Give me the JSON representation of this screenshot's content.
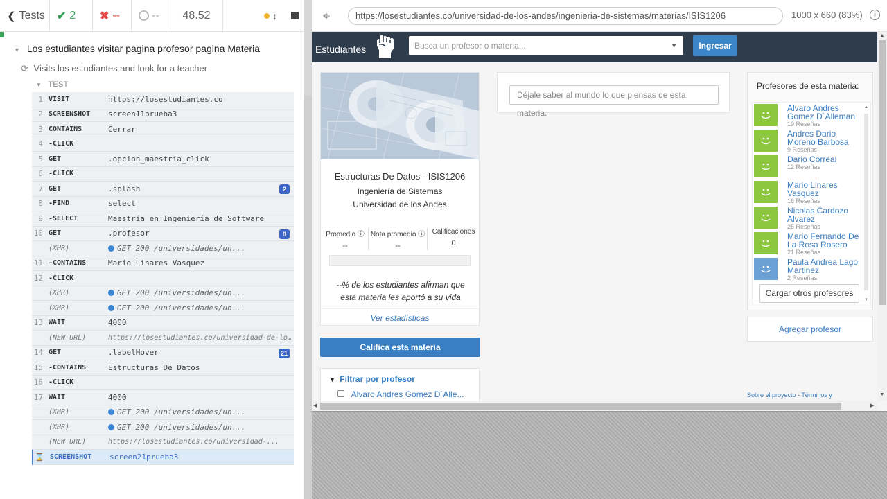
{
  "reporter": {
    "tests_label": "Tests",
    "passed": "2",
    "failed": "--",
    "pending": "--",
    "duration": "48.52",
    "suite_title": "Los estudiantes visitar pagina profesor pagina Materia",
    "test_title": "Visits los estudiantes and look for a teacher",
    "section_label": "TEST",
    "commands": [
      {
        "num": "1",
        "name": "VISIT",
        "msg": "https://losestudiantes.co",
        "kind": "cmd",
        "badge": ""
      },
      {
        "num": "2",
        "name": "SCREENSHOT",
        "msg": "screen11prueba3",
        "kind": "cmd",
        "badge": ""
      },
      {
        "num": "3",
        "name": "CONTAINS",
        "msg": "Cerrar",
        "kind": "cmd",
        "badge": ""
      },
      {
        "num": "4",
        "name": "-CLICK",
        "msg": "",
        "kind": "sub",
        "badge": ""
      },
      {
        "num": "5",
        "name": "GET",
        "msg": ".opcion_maestria_click",
        "kind": "cmd",
        "badge": ""
      },
      {
        "num": "6",
        "name": "-CLICK",
        "msg": "",
        "kind": "sub",
        "badge": ""
      },
      {
        "num": "7",
        "name": "GET",
        "msg": ".splash",
        "kind": "cmd",
        "badge": "2"
      },
      {
        "num": "8",
        "name": "-FIND",
        "msg": "select",
        "kind": "sub",
        "badge": ""
      },
      {
        "num": "9",
        "name": "-SELECT",
        "msg": "Maestría en Ingeniería de Software",
        "kind": "sub",
        "badge": ""
      },
      {
        "num": "10",
        "name": "GET",
        "msg": ".profesor",
        "kind": "cmd",
        "badge": "8"
      },
      {
        "num": "",
        "name": "(XHR)",
        "msg": "GET 200 /universidades/un...",
        "kind": "xhr",
        "badge": ""
      },
      {
        "num": "11",
        "name": "-CONTAINS",
        "msg": "Mario Linares Vasquez",
        "kind": "sub",
        "badge": ""
      },
      {
        "num": "12",
        "name": "-CLICK",
        "msg": "",
        "kind": "sub",
        "badge": ""
      },
      {
        "num": "",
        "name": "(XHR)",
        "msg": "GET 200 /universidades/un...",
        "kind": "xhr",
        "badge": ""
      },
      {
        "num": "",
        "name": "(XHR)",
        "msg": "GET 200 /universidades/un...",
        "kind": "xhr",
        "badge": ""
      },
      {
        "num": "13",
        "name": "WAIT",
        "msg": "4000",
        "kind": "cmd",
        "badge": ""
      },
      {
        "num": "",
        "name": "(NEW URL)",
        "msg": "https://losestudiantes.co/universidad-de-los-...",
        "kind": "url",
        "badge": ""
      },
      {
        "num": "14",
        "name": "GET",
        "msg": ".labelHover",
        "kind": "cmd",
        "badge": "21"
      },
      {
        "num": "15",
        "name": "-CONTAINS",
        "msg": "Estructuras De Datos",
        "kind": "sub",
        "badge": ""
      },
      {
        "num": "16",
        "name": "-CLICK",
        "msg": "",
        "kind": "sub",
        "badge": ""
      },
      {
        "num": "17",
        "name": "WAIT",
        "msg": "4000",
        "kind": "cmd",
        "badge": ""
      },
      {
        "num": "",
        "name": "(XHR)",
        "msg": "GET 200 /universidades/un...",
        "kind": "xhr",
        "badge": ""
      },
      {
        "num": "",
        "name": "(XHR)",
        "msg": "GET 200 /universidades/un...",
        "kind": "xhr",
        "badge": ""
      },
      {
        "num": "",
        "name": "(NEW URL)",
        "msg": "https://losestudiantes.co/universidad-...",
        "kind": "url",
        "badge": ""
      },
      {
        "num": "",
        "name": "SCREENSHOT",
        "msg": "screen21prueba3",
        "kind": "active",
        "badge": ""
      }
    ]
  },
  "aut_bar": {
    "url": "https://losestudiantes.co/universidad-de-los-andes/ingenieria-de-sistemas/materias/ISIS1206",
    "viewport": "1000 x 660",
    "scale": "(83%)"
  },
  "site": {
    "brand": "Estudiantes",
    "search_placeholder": "Busca un profesor o materia...",
    "login_label": "Ingresar",
    "course": {
      "name": "Estructuras De Datos - ISIS1206",
      "department": "Ingeniería de Sistemas",
      "university": "Universidad de los Andes",
      "stats": [
        {
          "label": "Promedio",
          "value": "--"
        },
        {
          "label": "Nota promedio",
          "value": "--"
        },
        {
          "label": "Calificaciones",
          "value": "0"
        }
      ],
      "percent_text": "--% de los estudiantes afirman que esta materia les aportó a su vida",
      "stats_link": "Ver estadísticas",
      "progress": 0
    },
    "rate_button": "Califica esta materia",
    "filter": {
      "title": "Filtrar por profesor",
      "first_item": "Alvaro Andres Gomez D`Alle..."
    },
    "comment_placeholder": "Déjale saber al mundo lo que piensas de esta materia.",
    "professors_title": "Profesores de esta materia:",
    "professors": [
      {
        "name": "Alvaro Andres Gomez D`Alleman",
        "reviews": "19 Reseñas",
        "avatar": "green"
      },
      {
        "name": "Andres Dario Moreno Barbosa",
        "reviews": "9 Reseñas",
        "avatar": "green"
      },
      {
        "name": "Dario Correal",
        "reviews": "12 Reseñas",
        "avatar": "green"
      },
      {
        "name": "Mario Linares Vasquez",
        "reviews": "16 Reseñas",
        "avatar": "green"
      },
      {
        "name": "Nicolas Cardozo Alvarez",
        "reviews": "25 Reseñas",
        "avatar": "green"
      },
      {
        "name": "Mario Fernando De La Rosa Rosero",
        "reviews": "21 Reseñas",
        "avatar": "green"
      },
      {
        "name": "Paula Andrea Lago Martinez",
        "reviews": "2 Reseñas",
        "avatar": "blue"
      }
    ],
    "load_more": "Cargar otros profesores",
    "add_professor": "Agregar profesor",
    "footer_about": "Sobre el proyecto",
    "footer_sep": "-",
    "footer_terms": "Términos y"
  }
}
